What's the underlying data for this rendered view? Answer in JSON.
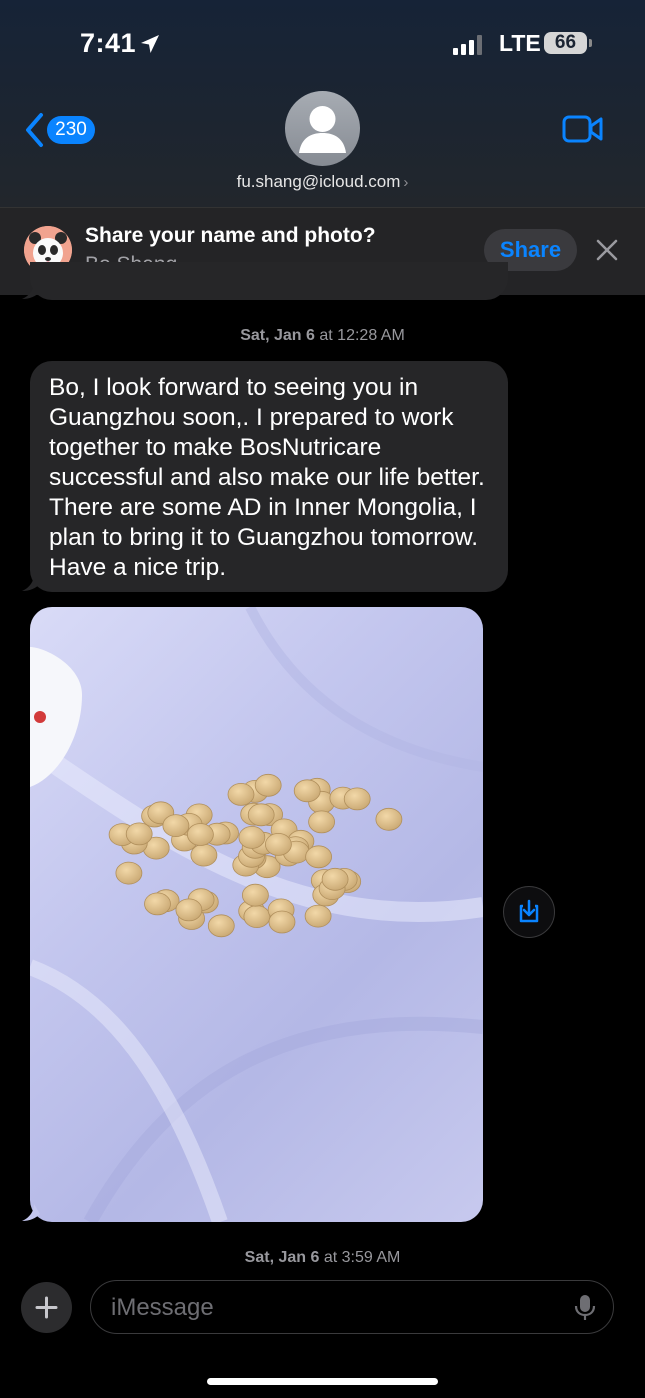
{
  "status_bar": {
    "time": "7:41",
    "network": "LTE",
    "battery": "66"
  },
  "nav": {
    "back_count": "230",
    "contact": "fu.shang@icloud.com",
    "contact_chevron": "›"
  },
  "share_banner": {
    "title": "Share your name and photo?",
    "name": "Bo Shang",
    "share_label": "Share"
  },
  "messages": [
    {
      "type": "timestamp",
      "day": "Sat, Jan 6",
      "connector": "at",
      "time": "12:28 AM"
    },
    {
      "type": "text",
      "direction": "incoming",
      "text": "Bo, I look forward to seeing you in Guangzhou soon,. I prepared to work together to make BosNutricare successful and also make our life better. There are some AD in Inner Mongolia, I plan to bring it to Guangzhou tomorrow. Have a nice trip."
    },
    {
      "type": "image",
      "direction": "incoming",
      "content": "photo"
    },
    {
      "type": "timestamp",
      "day": "Sat, Jan 6",
      "connector": "at",
      "time": "3:59 AM"
    }
  ],
  "composer": {
    "placeholder": "iMessage"
  },
  "icons": [
    "location-arrow-icon",
    "signal-icon",
    "battery-icon",
    "back-chevron-icon",
    "person-icon",
    "video-camera-icon",
    "memoji-icon",
    "close-icon",
    "save-download-icon",
    "plus-icon",
    "microphone-icon"
  ],
  "colors": {
    "accent": "#0a84ff",
    "bubble": "#262628",
    "background": "#000000"
  }
}
